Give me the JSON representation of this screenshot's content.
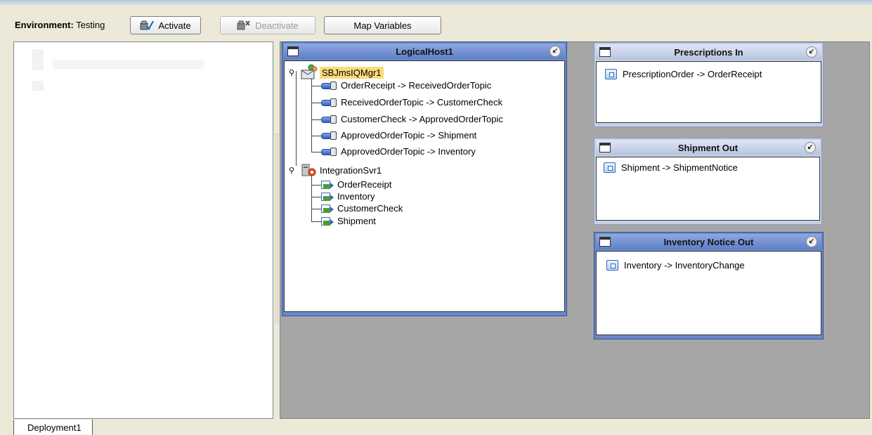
{
  "toolbar": {
    "environment_label": "Environment:",
    "environment_value": "Testing",
    "activate_label": "Activate",
    "deactivate_label": "Deactivate",
    "map_variables_label": "Map Variables"
  },
  "logical_host": {
    "title": "LogicalHost1",
    "jms_server": "SBJmsIQMgr1",
    "connections": [
      "OrderReceipt -> ReceivedOrderTopic",
      "ReceivedOrderTopic -> CustomerCheck",
      "CustomerCheck -> ApprovedOrderTopic",
      "ApprovedOrderTopic -> Shipment",
      "ApprovedOrderTopic -> Inventory"
    ],
    "integration_server": "IntegrationSvr1",
    "services": [
      "OrderReceipt",
      "Inventory",
      "CustomerCheck",
      "Shipment"
    ]
  },
  "externals": [
    {
      "title": "Prescriptions In",
      "item": "PrescriptionOrder -> OrderReceipt"
    },
    {
      "title": "Shipment Out",
      "item": "Shipment -> ShipmentNotice"
    },
    {
      "title": "Inventory Notice Out",
      "item": "Inventory -> InventoryChange"
    }
  ],
  "tabs": {
    "active": "Deployment1"
  },
  "icons": {
    "close": "collapse-icon",
    "window": "window-icon"
  }
}
